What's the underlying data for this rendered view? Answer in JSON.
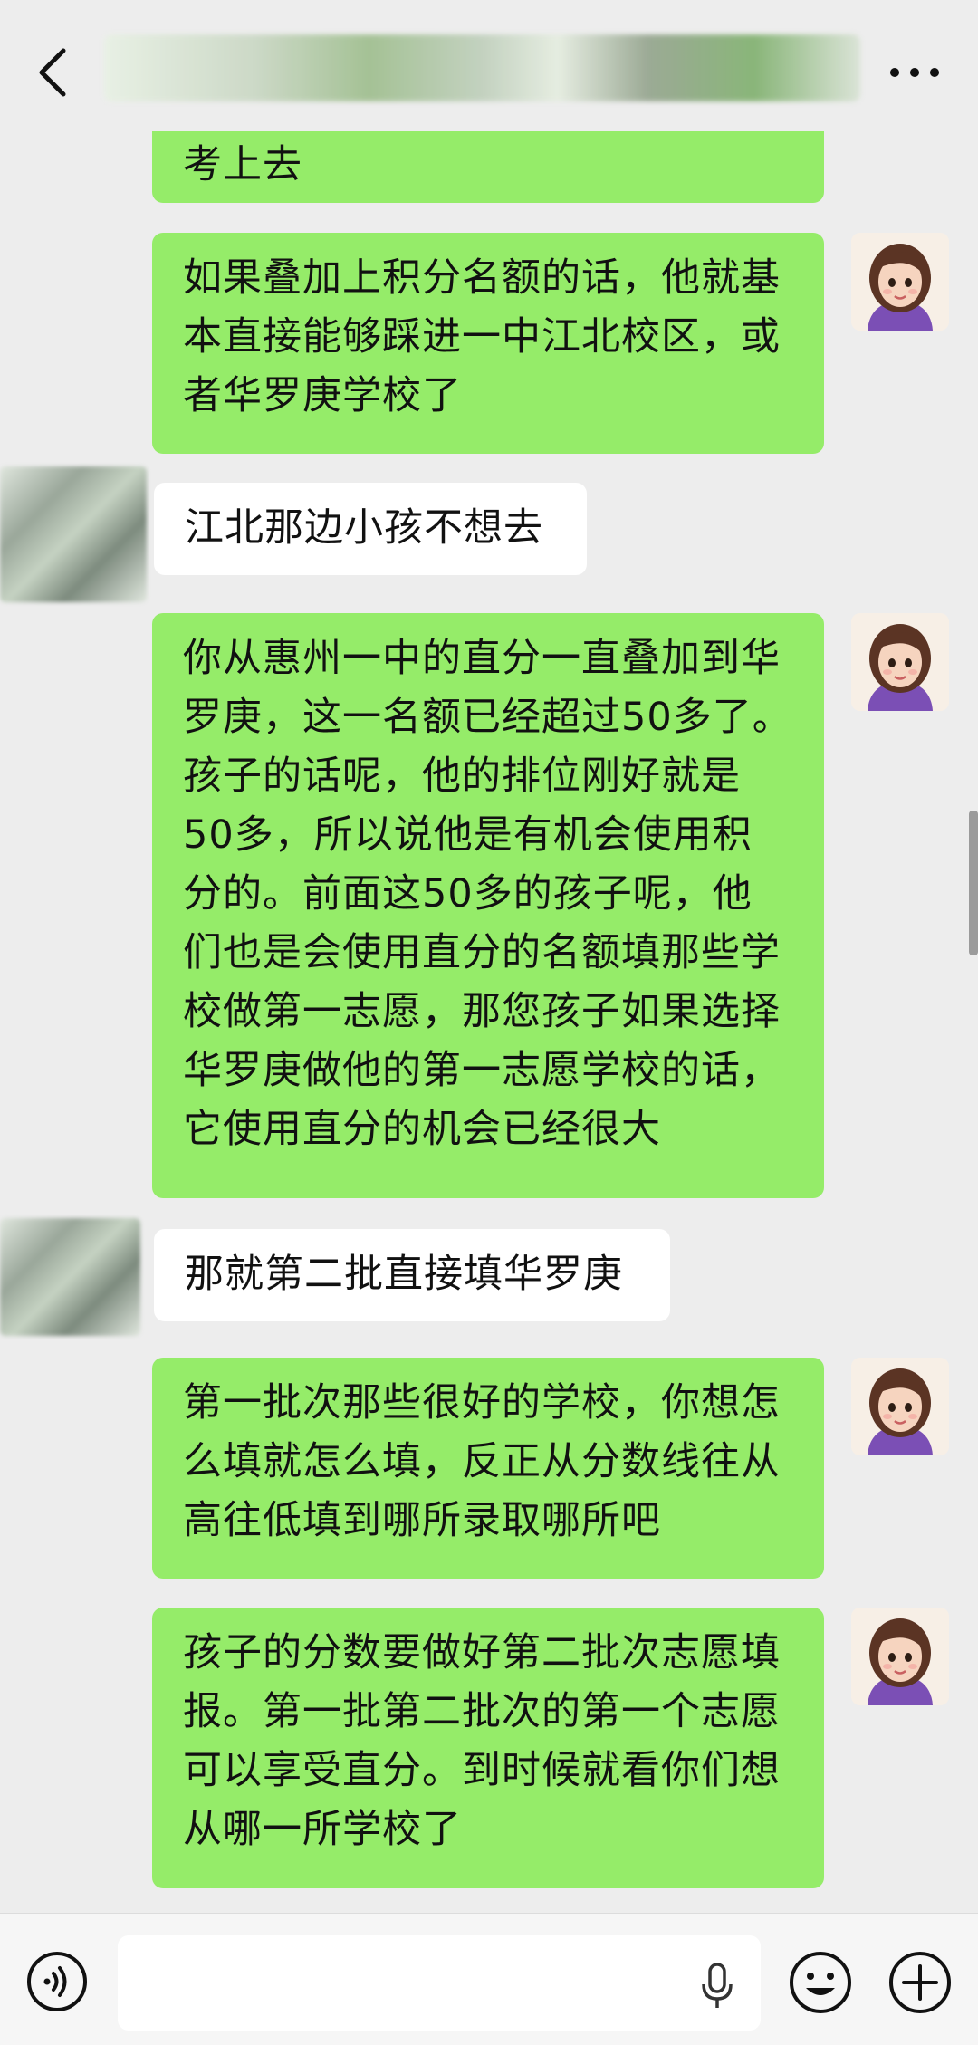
{
  "header": {
    "back_icon": "chevron-left-icon",
    "title_obscured": true,
    "more_icon": "more-dots-icon"
  },
  "messages": [
    {
      "side": "right",
      "text": "考上去"
    },
    {
      "side": "right",
      "text": "如果叠加上积分名额的话，他就基本直接能够踩进一中江北校区，或者华罗庚学校了"
    },
    {
      "side": "left",
      "text": "江北那边小孩不想去"
    },
    {
      "side": "right",
      "text": "你从惠州一中的直分一直叠加到华罗庚，这一名额已经超过50多了。孩子的话呢，他的排位刚好就是50多，所以说他是有机会使用积分的。前面这50多的孩子呢，他们也是会使用直分的名额填那些学校做第一志愿，那您孩子如果选择华罗庚做他的第一志愿学校的话，它使用直分的机会已经很大"
    },
    {
      "side": "left",
      "text": "那就第二批直接填华罗庚"
    },
    {
      "side": "right",
      "text": "第一批次那些很好的学校，你想怎么填就怎么填，反正从分数线往从高往低填到哪所录取哪所吧"
    },
    {
      "side": "right",
      "text": "孩子的分数要做好第二批次志愿填报。第一批第二批次的第一个志愿可以享受直分。到时候就看你们想从哪一所学校了"
    }
  ],
  "bubble_lines": [
    [
      "考上去"
    ],
    [
      "如果叠加上积分名额的话，他就基",
      "本直接能够踩进一中江北校区，或",
      "者华罗庚学校了"
    ],
    [
      "江北那边小孩不想去"
    ],
    [
      "你从惠州一中的直分一直叠加到华",
      "罗庚，这一名额已经超过50多了。",
      "孩子的话呢，他的排位刚好就是",
      "50多，所以说他是有机会使用积",
      "分的。前面这50多的孩子呢，他",
      "们也是会使用直分的名额填那些学",
      "校做第一志愿，那您孩子如果选择",
      "华罗庚做他的第一志愿学校的话，",
      "它使用直分的机会已经很大"
    ],
    [
      "那就第二批直接填华罗庚"
    ],
    [
      "第一批次那些很好的学校，你想怎",
      "么填就怎么填，反正从分数线往从",
      "高往低填到哪所录取哪所吧"
    ],
    [
      "孩子的分数要做好第二批次志愿填",
      "报。第一批第二批次的第一个志愿",
      "可以享受直分。到时候就看你们想",
      "从哪一所学校了"
    ]
  ],
  "input": {
    "value": "",
    "voice_icon": "voice-icon",
    "mic_icon": "microphone-icon",
    "emoji_icon": "emoji-icon",
    "plus_icon": "plus-icon"
  },
  "colors": {
    "background": "#EDEDED",
    "bubble_self": "#95EC69",
    "bubble_other": "#FFFFFF"
  }
}
